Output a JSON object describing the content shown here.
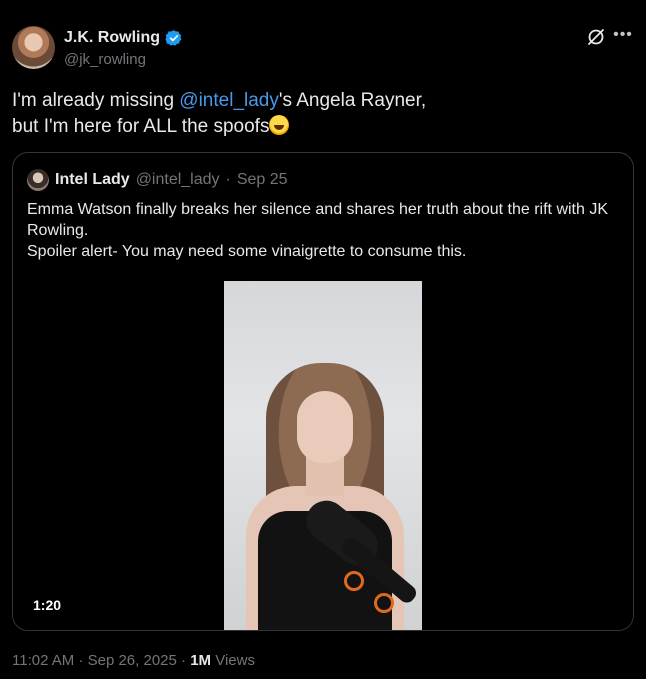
{
  "author": {
    "name": "J.K. Rowling",
    "handle": "@jk_rowling"
  },
  "post": {
    "text_part1": "I'm already missing ",
    "mention": "@intel_lady",
    "text_part2": "'s Angela Rayner,\nbut I'm here for ALL the spoofs",
    "emoji": "rolling-on-floor-laughing"
  },
  "quote": {
    "name": "Intel Lady",
    "handle": "@intel_lady",
    "separator": "·",
    "date": "Sep 25",
    "text": "Emma Watson finally breaks her silence and shares her truth about the rift with JK Rowling.\nSpoiler alert- You may need some vinaigrette to consume this.",
    "video_duration": "1:20"
  },
  "meta": {
    "time": "11:02 AM",
    "separator": "·",
    "date": "Sep 26, 2025",
    "views_count": "1M",
    "views_label": "Views"
  },
  "colors": {
    "background": "#000000",
    "text": "#e7e9ea",
    "muted": "#71767b",
    "link": "#4a99e9",
    "verified": "#1d9bf0",
    "border": "#333639"
  },
  "icons": {
    "verified": "verified-badge-icon",
    "grok": "grok-icon",
    "more": "more-icon"
  }
}
